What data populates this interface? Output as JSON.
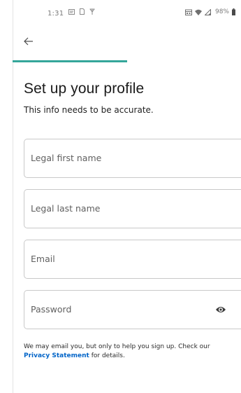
{
  "status_bar": {
    "time": "1:31",
    "battery": "98%"
  },
  "navigation": {
    "back_icon": "arrow-left-icon"
  },
  "progress": {
    "fraction": 0.5,
    "color": "#34a69a"
  },
  "header": {
    "title": "Set up your profile",
    "subtitle": "This info needs to be accurate."
  },
  "form": {
    "first_name_placeholder": "Legal first name",
    "last_name_placeholder": "Legal last name",
    "email_placeholder": "Email",
    "password_placeholder": "Password",
    "password_toggle_icon": "eye-icon"
  },
  "disclaimer": {
    "text_before": "We may email you, but only to help you sign up. Check our ",
    "link_text": "Privacy Statement",
    "text_after": " for details.",
    "link_color": "#0064c8"
  }
}
